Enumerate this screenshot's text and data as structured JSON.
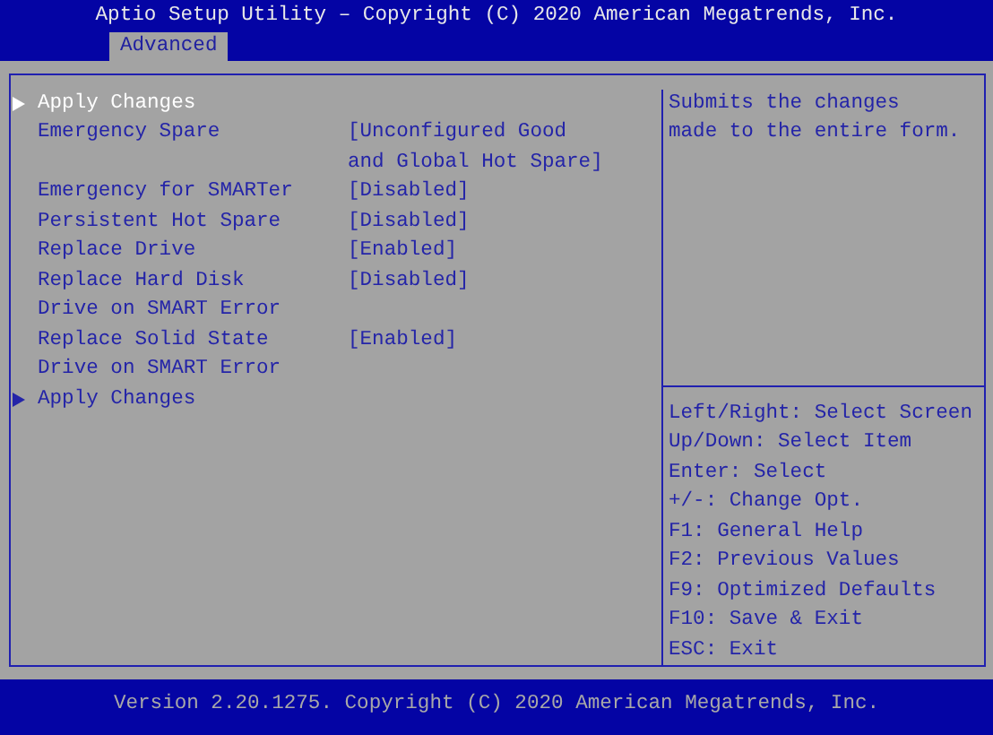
{
  "header": {
    "title": "Aptio Setup Utility – Copyright (C) 2020 American Megatrends, Inc."
  },
  "tabs": [
    {
      "label": "Advanced",
      "selected": true
    }
  ],
  "items": [
    {
      "kind": "submenu",
      "label": [
        "Apply Changes"
      ],
      "selected": true
    },
    {
      "kind": "setting",
      "label": [
        "Emergency Spare"
      ],
      "value": [
        "[Unconfigured Good",
        "and Global Hot Spare]"
      ],
      "selected": false
    },
    {
      "kind": "setting",
      "label": [
        "Emergency for SMARTer"
      ],
      "value": [
        "[Disabled]"
      ],
      "selected": false
    },
    {
      "kind": "setting",
      "label": [
        "Persistent Hot Spare"
      ],
      "value": [
        "[Disabled]"
      ],
      "selected": false
    },
    {
      "kind": "setting",
      "label": [
        "Replace Drive"
      ],
      "value": [
        "[Enabled]"
      ],
      "selected": false
    },
    {
      "kind": "setting",
      "label": [
        "Replace Hard Disk",
        "Drive on SMART Error"
      ],
      "value": [
        "[Disabled]"
      ],
      "selected": false
    },
    {
      "kind": "setting",
      "label": [
        "Replace Solid State",
        "Drive on SMART Error"
      ],
      "value": [
        "[Enabled]"
      ],
      "selected": false
    },
    {
      "kind": "submenu",
      "label": [
        "Apply Changes"
      ],
      "selected": false
    }
  ],
  "help": [
    "Submits the changes",
    "made to the entire form."
  ],
  "keys": [
    "Left/Right: Select Screen",
    "Up/Down: Select Item",
    "Enter: Select",
    "+/-: Change Opt.",
    "F1: General Help",
    "F2: Previous Values",
    "F9: Optimized Defaults",
    "F10: Save & Exit",
    "ESC: Exit"
  ],
  "footer": {
    "text": "Version 2.20.1275. Copyright (C) 2020 American Megatrends, Inc."
  }
}
